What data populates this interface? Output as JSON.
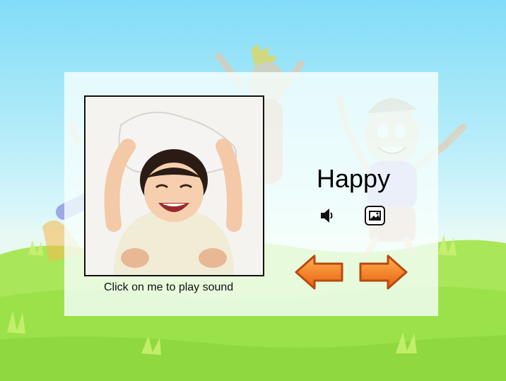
{
  "lesson": {
    "word": "Happy",
    "caption": "Click on me to play sound"
  },
  "photo": {
    "subject": "smiling boy holding a pillow over his head"
  },
  "icons": {
    "sound": "speaker-icon",
    "picture": "picture-icon",
    "previous": "arrow-left-icon",
    "next": "arrow-right-icon"
  },
  "colors": {
    "sky_top": "#82dcf8",
    "grass": "#9be24a",
    "arrow_orange": "#f07820",
    "arrow_outline": "#b84a10"
  }
}
